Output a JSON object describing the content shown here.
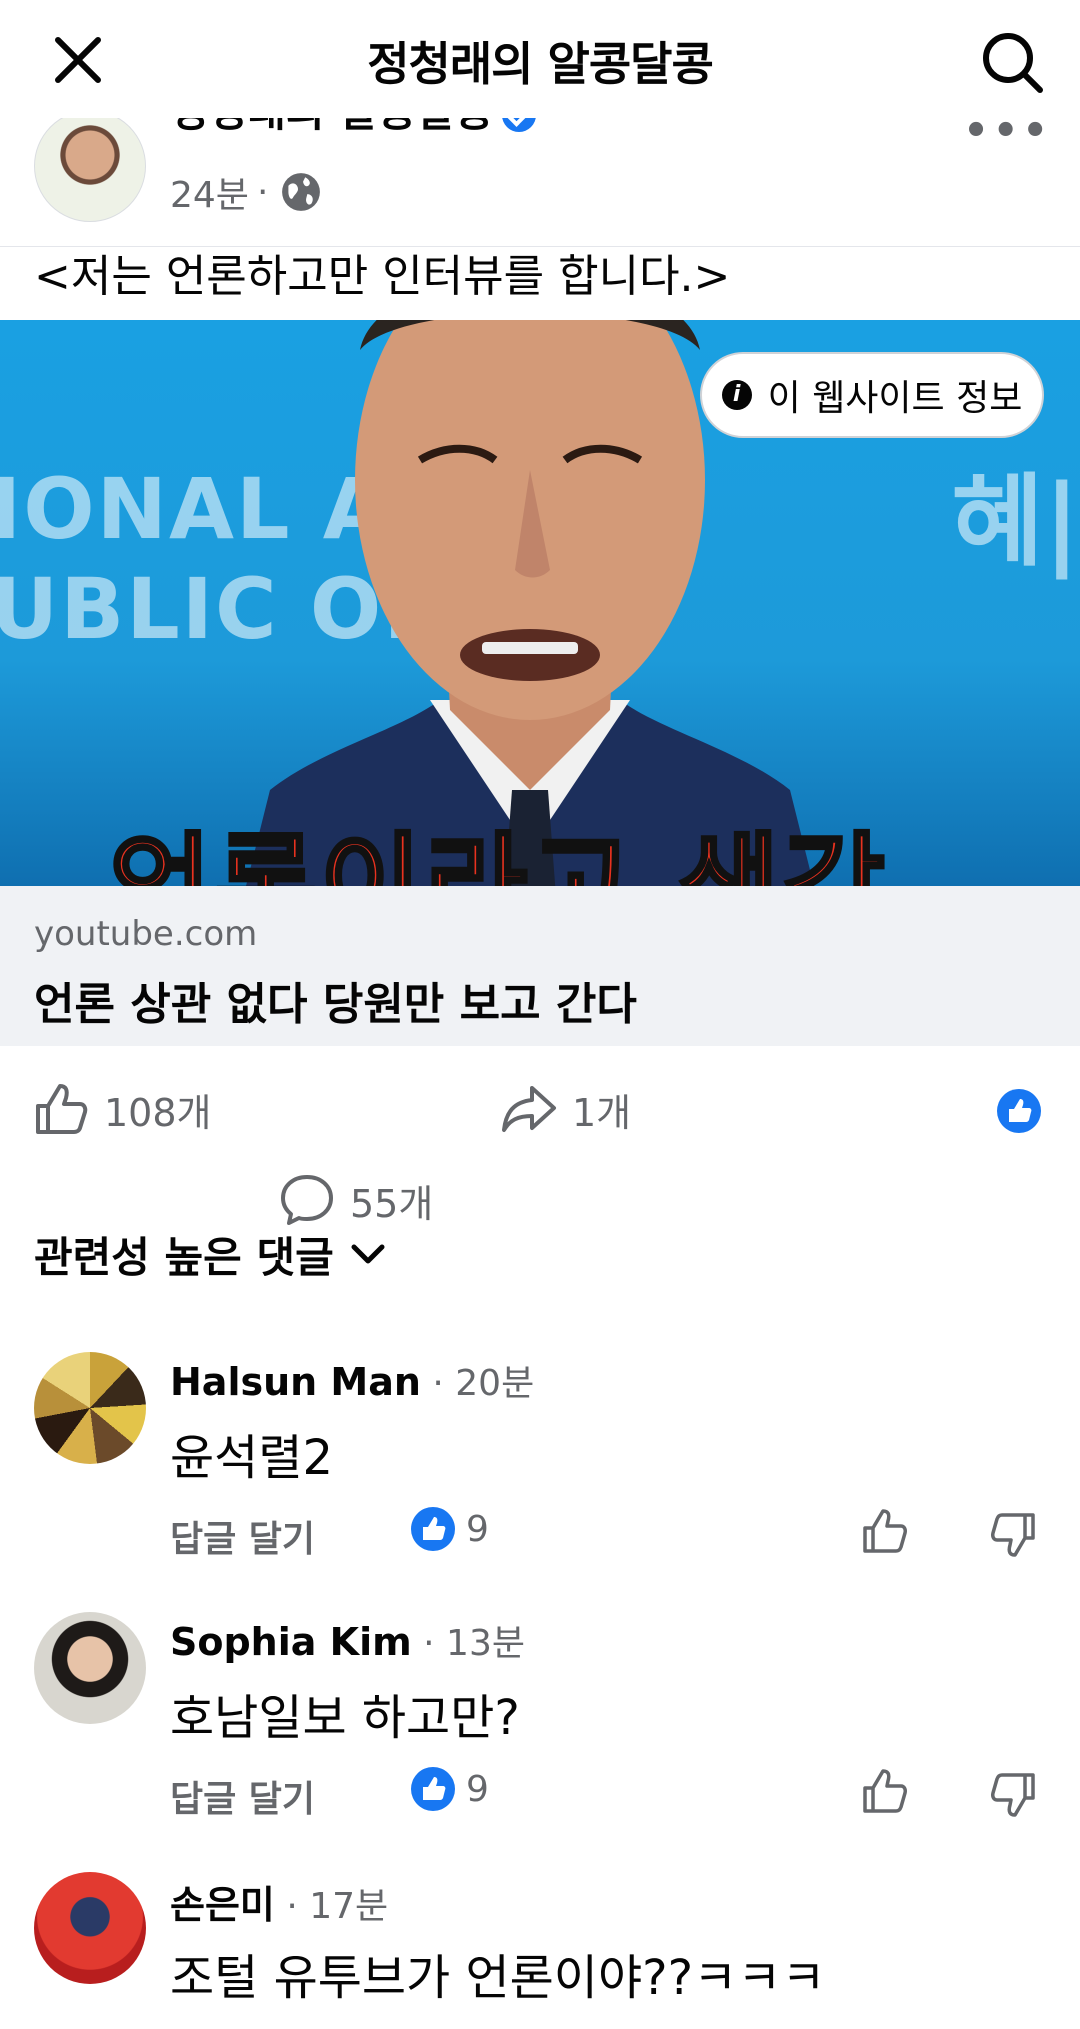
{
  "header": {
    "title": "정청래의 알콩달콩",
    "close_icon": "close-icon",
    "search_icon": "search-icon"
  },
  "post": {
    "page_name": "정청래의 알콩달콩",
    "time": "24분",
    "separator": "·",
    "audience_icon": "globe-icon",
    "text": "<저는 언론하고만 인터뷰를 합니다.>",
    "link": {
      "site_info_label": "이 웹사이트 정보",
      "thumbnail_bg_text_1": "IONAL ASS",
      "thumbnail_bg_text_2": "UBLIC OF K",
      "thumbnail_bg_text_right": "혜|",
      "thumbnail_caption": "언론이라고 생각",
      "domain": "youtube.com",
      "title": "언론 상관 없다 당원만 보고 간다"
    },
    "stats": {
      "likes": "108개",
      "comments": "55개",
      "shares": "1개"
    }
  },
  "comments_section": {
    "sort_label": "관련성 높은 댓글",
    "reply_label": "답글 달기",
    "items": [
      {
        "name": "Halsun Man",
        "time": "20분",
        "text": "윤석렬2",
        "likes": "9"
      },
      {
        "name": "Sophia Kim",
        "time": "13분",
        "text": "호남일보  하고만?",
        "likes": "9"
      },
      {
        "name": "손은미",
        "time": "17분",
        "text": "조털 유투브가 언론이야??ㅋㅋㅋ"
      }
    ]
  },
  "colors": {
    "accent": "#1877f2",
    "secondary_text": "#65676b",
    "link_bg": "#f0f2f5",
    "thumbnail_bg": "#1aa0e2",
    "caption_red": "#e8321f"
  }
}
